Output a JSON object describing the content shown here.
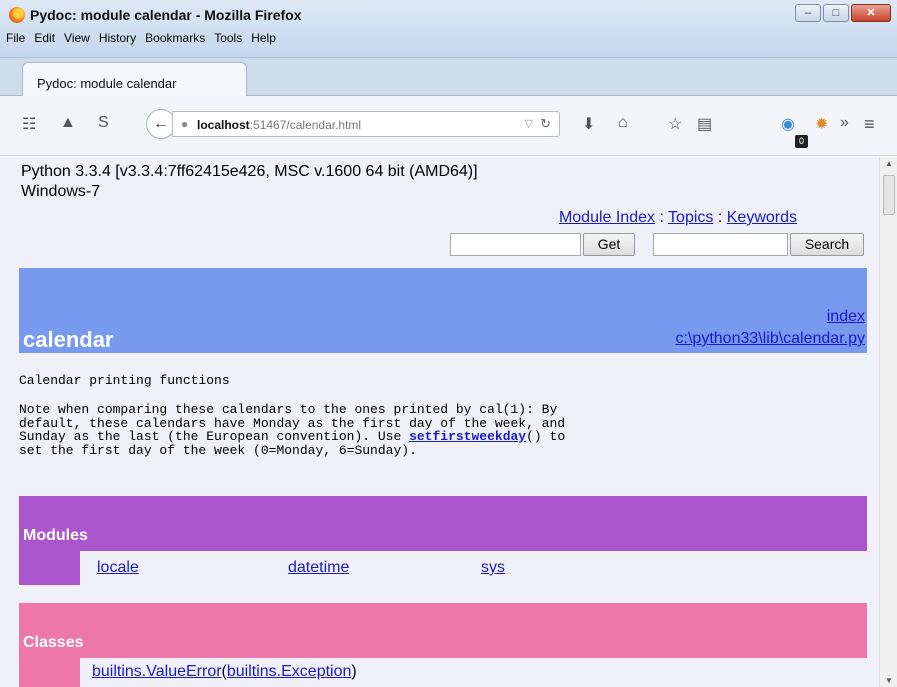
{
  "window": {
    "title": "Pydoc: module calendar - Mozilla Firefox",
    "menu": [
      "File",
      "Edit",
      "View",
      "History",
      "Bookmarks",
      "Tools",
      "Help"
    ],
    "controls": {
      "minimize": "–",
      "maximize": "□",
      "close": "✕"
    }
  },
  "tab": {
    "label": "Pydoc: module calendar"
  },
  "navbar": {
    "url_host": "localhost",
    "url_rest": ":51467/calendar.html",
    "ghost_badge": "0",
    "icons": [
      "rss-icon",
      "pocket-icon",
      "sync-icon",
      "download-icon",
      "home-icon",
      "star-icon",
      "reading-list-icon",
      "ghost-icon",
      "addon-icon",
      "overflow-icon",
      "hamburger-menu-icon"
    ]
  },
  "page": {
    "python_version": "Python 3.3.4 [v3.3.4:7ff62415e426, MSC v.1600 64 bit (AMD64)]",
    "os": "Windows-7",
    "nav": {
      "module_index": "Module Index",
      "sep1": " : ",
      "topics": "Topics",
      "sep2": " : ",
      "keywords": "Keywords"
    },
    "get_button": "Get",
    "search_button": "Search",
    "module_name": "calendar",
    "index_link": "index",
    "file_link": "c:\\python33\\lib\\calendar.py",
    "desc_line1": "Calendar printing functions",
    "desc_p1": "Note when comparing these calendars to the ones printed by cal(1): By",
    "desc_p2": "default, these calendars have Monday as the first day of the week, and",
    "desc_p3_pre": "Sunday as the last (the European convention). Use ",
    "desc_p3_link": "setfirstweekday",
    "desc_p3_post": "() to",
    "desc_p4": "set the first day of the week (0=Monday, 6=Sunday).",
    "modules_title": "Modules",
    "modules": [
      "locale",
      "datetime",
      "sys"
    ],
    "classes_title": "Classes",
    "class_link": "builtins.ValueError",
    "class_paren_open": "(",
    "class_base": "builtins.Exception",
    "class_paren_close": ")"
  }
}
